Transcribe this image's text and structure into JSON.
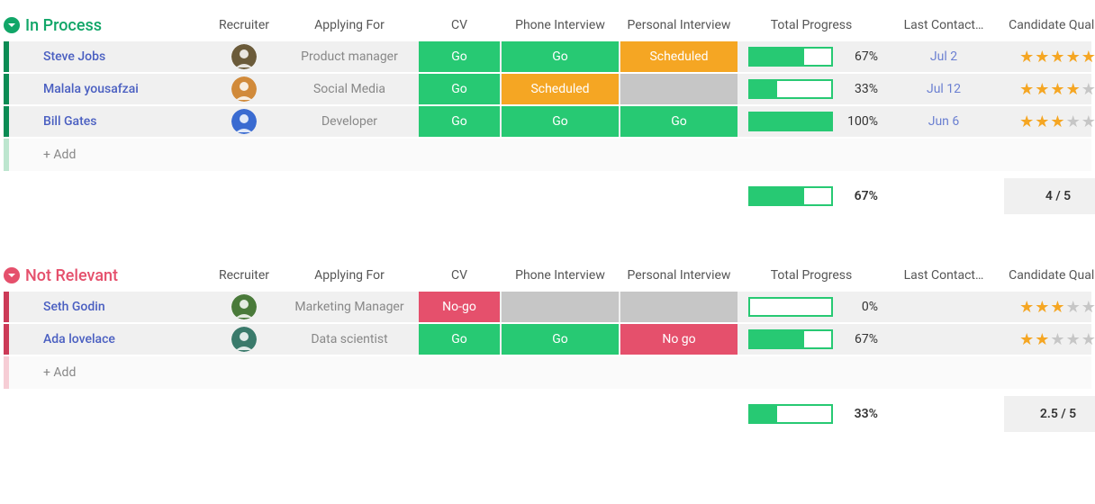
{
  "columns": {
    "recruiter": "Recruiter",
    "applying_for": "Applying For",
    "cv": "CV",
    "phone": "Phone Interview",
    "personal": "Personal Interview",
    "progress": "Total Progress",
    "last_contact": "Last Contact…",
    "quality": "Candidate Quality"
  },
  "status_labels": {
    "go": "Go",
    "scheduled": "Scheduled",
    "nogo": "No-go",
    "nogo2": "No go"
  },
  "add_label": "+ Add",
  "groups": [
    {
      "title": "In Process",
      "color": "#11a668",
      "handle_color": "#0a8c54",
      "add_handle_color": "#7fd1a3",
      "rows": [
        {
          "name": "Steve Jobs",
          "avatar_bg": "#6b5b3a",
          "apply": "Product manager",
          "cv": "go",
          "phone": "go",
          "personal": "scheduled",
          "progress": 67,
          "progress_label": "67%",
          "date": "Jul 2",
          "stars": 5
        },
        {
          "name": "Malala yousafzai",
          "avatar_bg": "#d18a3a",
          "apply": "Social Media",
          "cv": "go",
          "phone": "scheduled",
          "personal": "empty",
          "progress": 33,
          "progress_label": "33%",
          "date": "Jul 12",
          "stars": 4
        },
        {
          "name": "Bill Gates",
          "avatar_bg": "#3a6bd1",
          "apply": "Developer",
          "cv": "go",
          "phone": "go",
          "personal": "go",
          "progress": 100,
          "progress_label": "100%",
          "date": "Jun 6",
          "stars": 3
        }
      ],
      "summary": {
        "progress": 67,
        "progress_label": "67%",
        "quality": "4 / 5"
      }
    },
    {
      "title": "Not Relevant",
      "color": "#e5506c",
      "handle_color": "#cc3a57",
      "add_handle_color": "#f2a0b0",
      "rows": [
        {
          "name": "Seth Godin",
          "avatar_bg": "#4a7a3a",
          "apply": "Marketing Manager",
          "cv": "nogo",
          "phone": "empty",
          "personal": "empty",
          "progress": 0,
          "progress_label": "0%",
          "date": "",
          "stars": 3
        },
        {
          "name": "Ada lovelace",
          "avatar_bg": "#3a7a6b",
          "apply": "Data scientist",
          "cv": "go",
          "phone": "go",
          "personal": "nogo2",
          "progress": 67,
          "progress_label": "67%",
          "date": "",
          "stars": 2
        }
      ],
      "summary": {
        "progress": 33,
        "progress_label": "33%",
        "quality": "2.5 / 5"
      }
    }
  ]
}
